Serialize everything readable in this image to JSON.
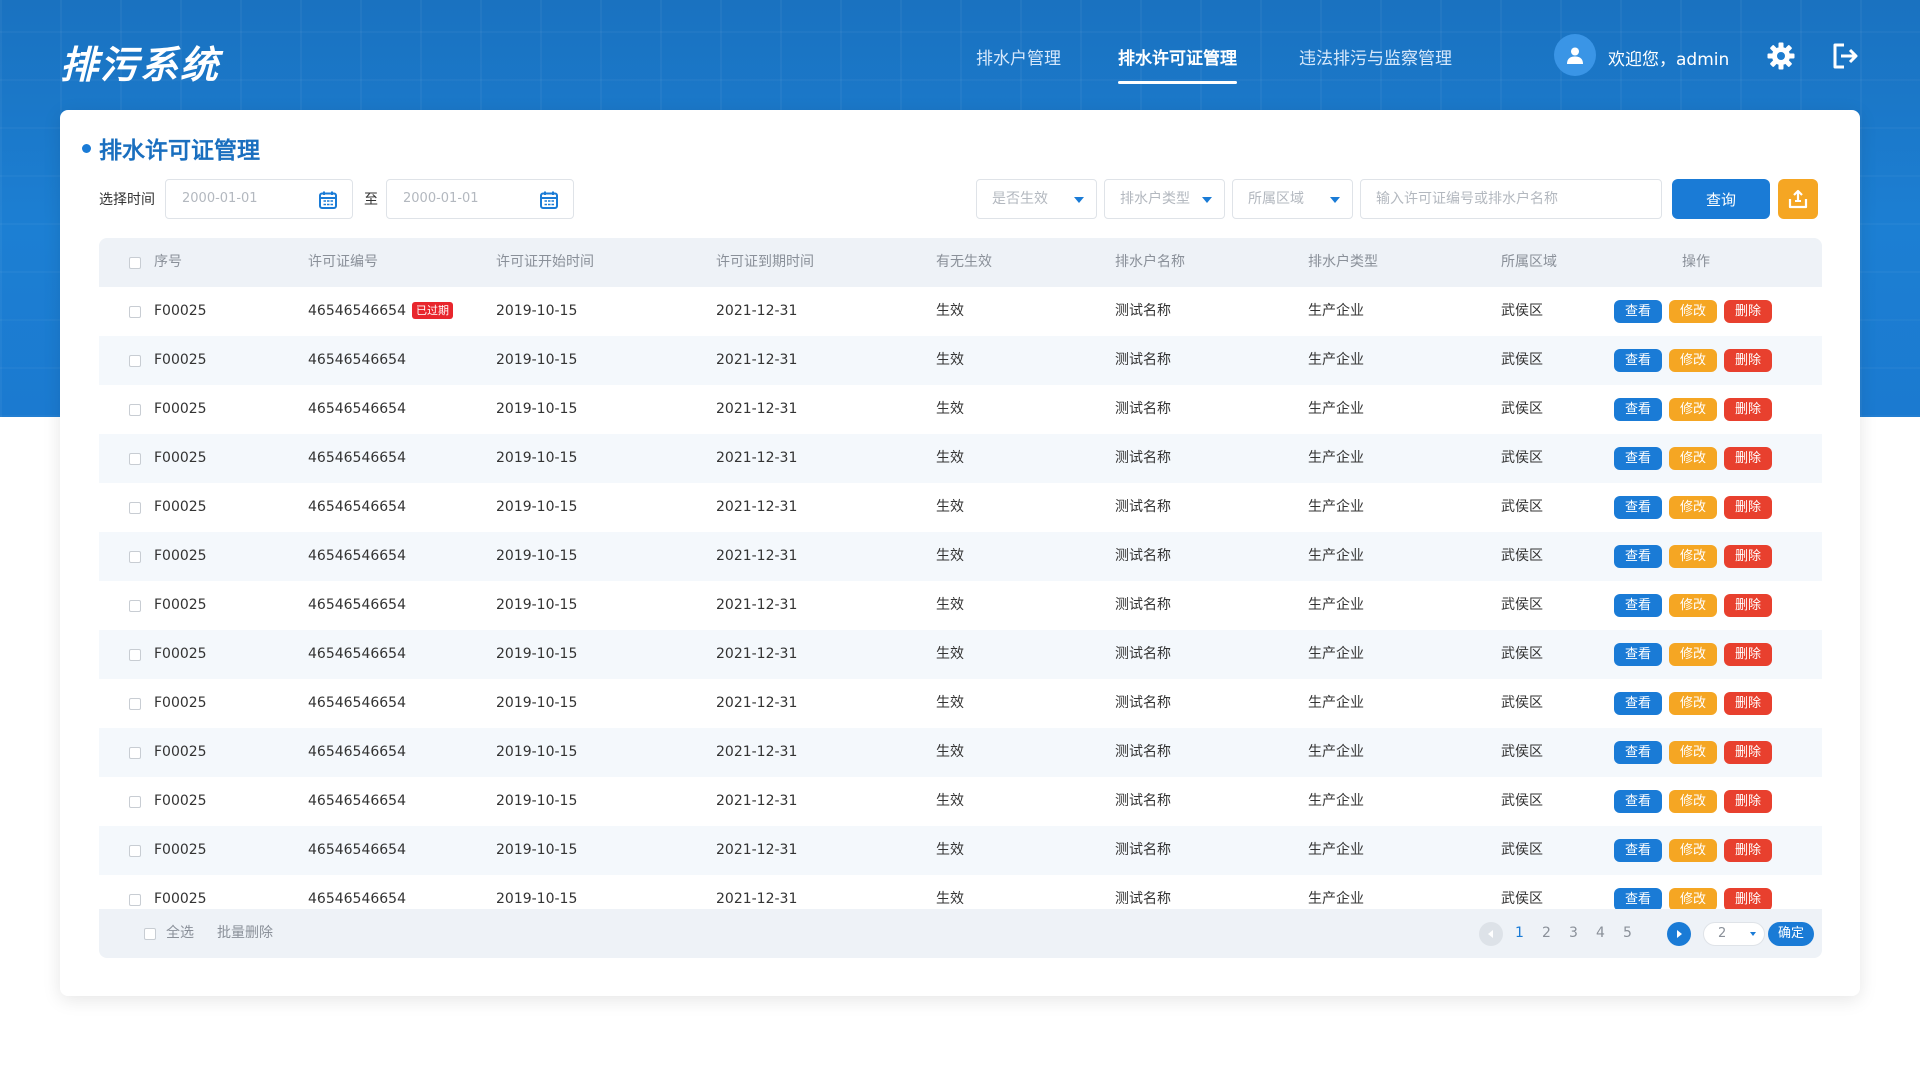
{
  "app": {
    "title": "排污系统"
  },
  "nav": {
    "items": [
      {
        "label": "排水户管理",
        "active": false
      },
      {
        "label": "排水许可证管理",
        "active": true
      },
      {
        "label": "违法排污与监察管理",
        "active": false
      }
    ]
  },
  "user": {
    "welcome": "欢迎您，admin"
  },
  "icons": {
    "avatar": "user-icon",
    "settings": "gear-icon",
    "logout": "logout-icon",
    "calendar": "calendar-icon",
    "export": "export-icon"
  },
  "page": {
    "title": "排水许可证管理"
  },
  "filters": {
    "time_label": "选择时间",
    "to_label": "至",
    "start_date_placeholder": "2000-01-01",
    "end_date_placeholder": "2000-01-01",
    "effective_placeholder": "是否生效",
    "type_placeholder": "排水户类型",
    "area_placeholder": "所属区域",
    "search_placeholder": "输入许可证编号或排水户名称",
    "query_label": "查询"
  },
  "table": {
    "headers": [
      "序号",
      "许可证编号",
      "许可证开始时间",
      "许可证到期时间",
      "有无生效",
      "排水户名称",
      "排水户类型",
      "所属区域",
      "操作"
    ],
    "expired_badge": "已过期",
    "actions": {
      "view": "查看",
      "edit": "修改",
      "delete": "删除"
    },
    "rows": [
      {
        "no": "F00025",
        "license": "46546546654",
        "expired": true,
        "start": "2019-10-15",
        "end": "2021-12-31",
        "status": "生效",
        "name": "测试名称",
        "type": "生产企业",
        "area": "武侯区"
      },
      {
        "no": "F00025",
        "license": "46546546654",
        "expired": false,
        "start": "2019-10-15",
        "end": "2021-12-31",
        "status": "生效",
        "name": "测试名称",
        "type": "生产企业",
        "area": "武侯区"
      },
      {
        "no": "F00025",
        "license": "46546546654",
        "expired": false,
        "start": "2019-10-15",
        "end": "2021-12-31",
        "status": "生效",
        "name": "测试名称",
        "type": "生产企业",
        "area": "武侯区"
      },
      {
        "no": "F00025",
        "license": "46546546654",
        "expired": false,
        "start": "2019-10-15",
        "end": "2021-12-31",
        "status": "生效",
        "name": "测试名称",
        "type": "生产企业",
        "area": "武侯区"
      },
      {
        "no": "F00025",
        "license": "46546546654",
        "expired": false,
        "start": "2019-10-15",
        "end": "2021-12-31",
        "status": "生效",
        "name": "测试名称",
        "type": "生产企业",
        "area": "武侯区"
      },
      {
        "no": "F00025",
        "license": "46546546654",
        "expired": false,
        "start": "2019-10-15",
        "end": "2021-12-31",
        "status": "生效",
        "name": "测试名称",
        "type": "生产企业",
        "area": "武侯区"
      },
      {
        "no": "F00025",
        "license": "46546546654",
        "expired": false,
        "start": "2019-10-15",
        "end": "2021-12-31",
        "status": "生效",
        "name": "测试名称",
        "type": "生产企业",
        "area": "武侯区"
      },
      {
        "no": "F00025",
        "license": "46546546654",
        "expired": false,
        "start": "2019-10-15",
        "end": "2021-12-31",
        "status": "生效",
        "name": "测试名称",
        "type": "生产企业",
        "area": "武侯区"
      },
      {
        "no": "F00025",
        "license": "46546546654",
        "expired": false,
        "start": "2019-10-15",
        "end": "2021-12-31",
        "status": "生效",
        "name": "测试名称",
        "type": "生产企业",
        "area": "武侯区"
      },
      {
        "no": "F00025",
        "license": "46546546654",
        "expired": false,
        "start": "2019-10-15",
        "end": "2021-12-31",
        "status": "生效",
        "name": "测试名称",
        "type": "生产企业",
        "area": "武侯区"
      },
      {
        "no": "F00025",
        "license": "46546546654",
        "expired": false,
        "start": "2019-10-15",
        "end": "2021-12-31",
        "status": "生效",
        "name": "测试名称",
        "type": "生产企业",
        "area": "武侯区"
      },
      {
        "no": "F00025",
        "license": "46546546654",
        "expired": false,
        "start": "2019-10-15",
        "end": "2021-12-31",
        "status": "生效",
        "name": "测试名称",
        "type": "生产企业",
        "area": "武侯区"
      },
      {
        "no": "F00025",
        "license": "46546546654",
        "expired": false,
        "start": "2019-10-15",
        "end": "2021-12-31",
        "status": "生效",
        "name": "测试名称",
        "type": "生产企业",
        "area": "武侯区"
      }
    ]
  },
  "footer": {
    "select_all": "全选",
    "batch_delete": "批量删除",
    "pages": [
      "1",
      "2",
      "3",
      "4",
      "5"
    ],
    "current_page": "1",
    "page_select_value": "2",
    "confirm_label": "确定"
  },
  "colors": {
    "brand_blue": "#1a7bd6",
    "edit_orange": "#f5a623",
    "delete_red": "#e8402e",
    "expired_red": "#e8262d"
  }
}
